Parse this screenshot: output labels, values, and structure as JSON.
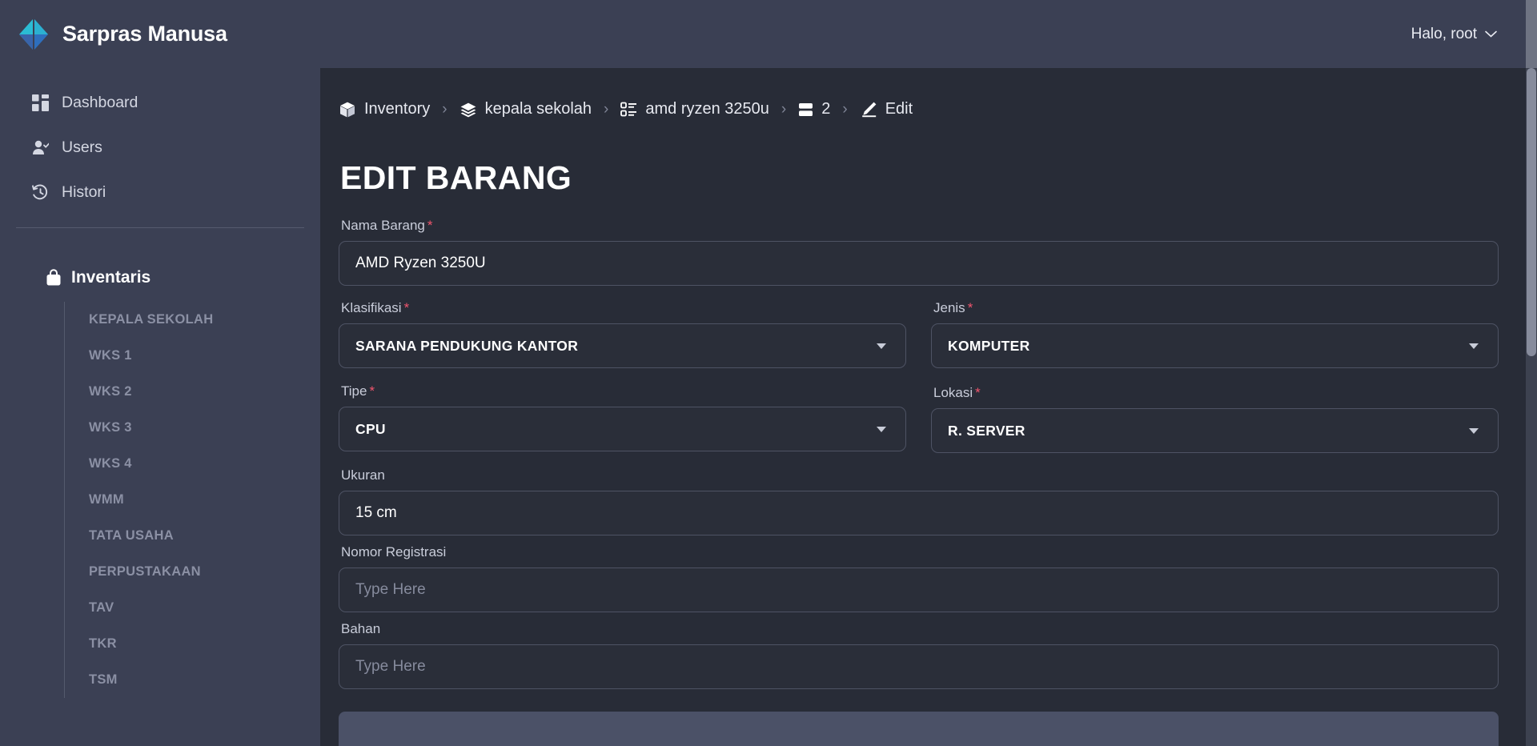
{
  "app": {
    "brand_name": "Sarpras Manusa",
    "logo_icon": "chevron-diamond-logo",
    "user_greeting": "Halo, root",
    "user_chevron_icon": "chevron-down-icon"
  },
  "sidebar": {
    "nav": [
      {
        "label": "Dashboard",
        "icon": "dashboard-grid-icon"
      },
      {
        "label": "Users",
        "icon": "user-check-icon"
      },
      {
        "label": "Histori",
        "icon": "history-clock-icon"
      }
    ],
    "section": {
      "label": "Inventaris",
      "icon": "bag-icon"
    },
    "sub_items": [
      "KEPALA SEKOLAH",
      "WKS 1",
      "WKS 2",
      "WKS 3",
      "WKS 4",
      "WMM",
      "TATA USAHA",
      "PERPUSTAKAAN",
      "TAV",
      "TKR",
      "TSM"
    ]
  },
  "breadcrumb": [
    {
      "label": "Inventory",
      "icon": "box-icon"
    },
    {
      "label": "kepala sekolah",
      "icon": "layers-icon"
    },
    {
      "label": "amd ryzen 3250u",
      "icon": "list-details-icon"
    },
    {
      "label": "2",
      "icon": "rows-icon"
    },
    {
      "label": "Edit",
      "icon": "pencil-icon"
    }
  ],
  "breadcrumb_separator": "›",
  "page": {
    "title": "EDIT BARANG"
  },
  "form": {
    "nama_barang": {
      "label": "Nama Barang",
      "required": true,
      "value": "AMD Ryzen 3250U",
      "placeholder": "Type Here"
    },
    "klasifikasi": {
      "label": "Klasifikasi",
      "required": true,
      "value": "SARANA PENDUKUNG KANTOR"
    },
    "jenis": {
      "label": "Jenis",
      "required": true,
      "value": "KOMPUTER"
    },
    "tipe": {
      "label": "Tipe",
      "required": true,
      "value": "CPU"
    },
    "lokasi": {
      "label": "Lokasi",
      "required": true,
      "value": "R. SERVER"
    },
    "ukuran": {
      "label": "Ukuran",
      "required": false,
      "value": "15 cm",
      "placeholder": "Type Here"
    },
    "nomor_registrasi": {
      "label": "Nomor Registrasi",
      "required": false,
      "value": "",
      "placeholder": "Type Here"
    },
    "bahan": {
      "label": "Bahan",
      "required": false,
      "value": "",
      "placeholder": "Type Here"
    },
    "required_marker": "*"
  },
  "colors": {
    "sidebar_bg": "#3b4054",
    "main_bg": "#282c37",
    "input_bg": "#2a2e39",
    "accent_cyan": "#29b6d8",
    "accent_blue": "#3d5a9e",
    "required_red": "#f0556d",
    "muted_text": "#8b90a4"
  }
}
